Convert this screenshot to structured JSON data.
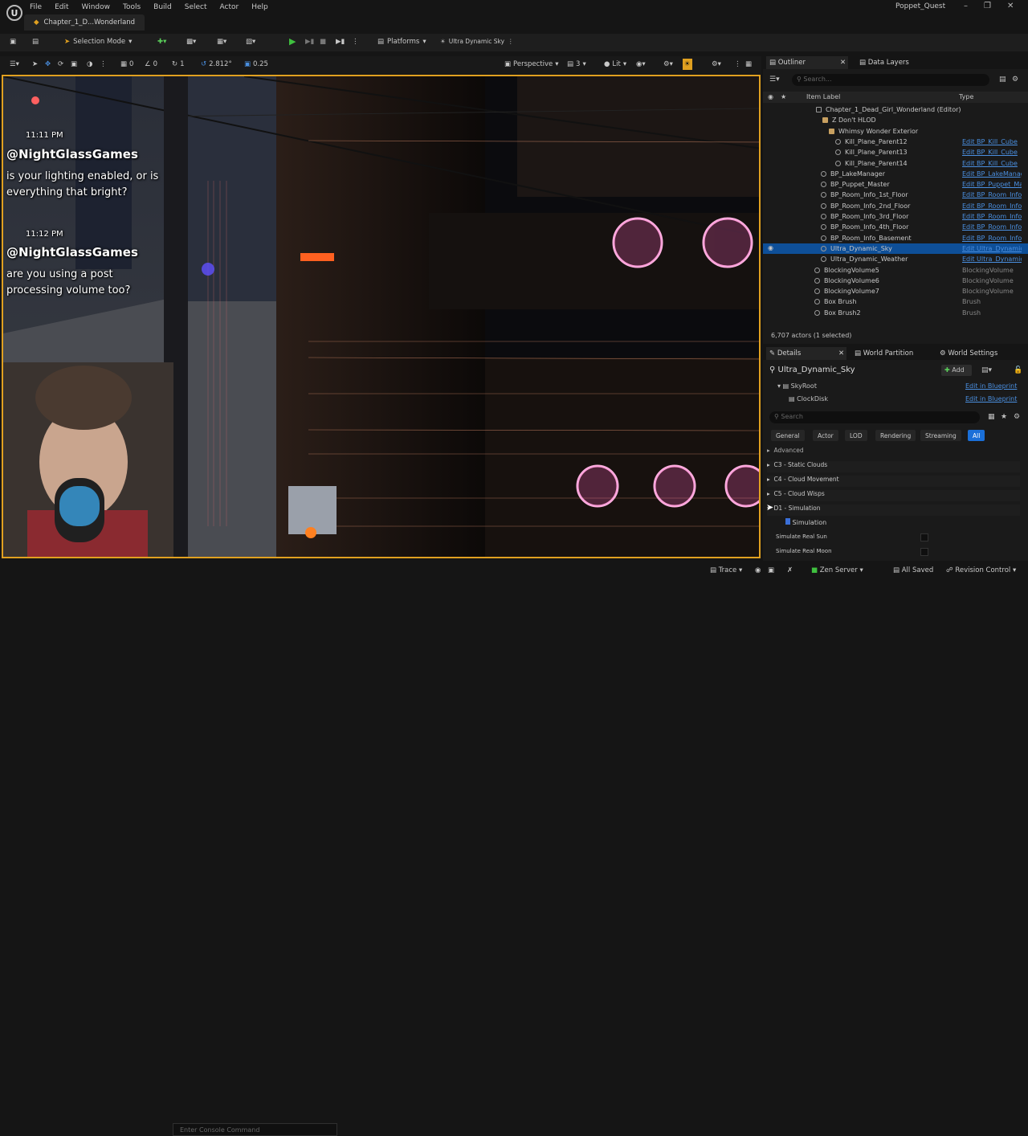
{
  "menu": [
    "File",
    "Edit",
    "Window",
    "Tools",
    "Build",
    "Select",
    "Actor",
    "Help"
  ],
  "project_name": "Poppet_Quest",
  "map_tab": "Chapter_1_D...Wonderland",
  "toolbar": {
    "selection_mode": "Selection Mode",
    "platforms": "Platforms",
    "sky": "Ultra Dynamic Sky"
  },
  "viewport_toolbar": {
    "snap_angle": "2.812°",
    "snap_scale": "0.25",
    "perspective": "Perspective",
    "lit": "Lit",
    "grid": "1",
    "angle": "0",
    "cam_speed": "3"
  },
  "chat": [
    {
      "time": "11:11 PM",
      "user": "@NightGlassGames",
      "text": "is your lighting enabled, or is everything that bright?"
    },
    {
      "time": "11:12 PM",
      "user": "@NightGlassGames",
      "text": "are you using a post processing volume too?"
    }
  ],
  "outliner": {
    "tab": "Outliner",
    "tab2": "Data Layers",
    "search_placeholder": "Search...",
    "col_label": "Item Label",
    "col_type": "Type",
    "rows": [
      {
        "label": "Chapter_1_Dead_Girl_Wonderland (Editor)",
        "type": ""
      },
      {
        "label": "Z Don't HLOD",
        "type": ""
      },
      {
        "label": "Whimsy Wonder Exterior",
        "type": ""
      },
      {
        "label": "Kill_Plane_Parent12",
        "type": "Edit BP_Kill_Cube"
      },
      {
        "label": "Kill_Plane_Parent13",
        "type": "Edit BP_Kill_Cube"
      },
      {
        "label": "Kill_Plane_Parent14",
        "type": "Edit BP_Kill_Cube"
      },
      {
        "label": "BP_LakeManager",
        "type": "Edit BP_LakeManag"
      },
      {
        "label": "BP_Puppet_Master",
        "type": "Edit BP_Puppet_Maste"
      },
      {
        "label": "BP_Room_Info_1st_Floor",
        "type": "Edit BP_Room_Info"
      },
      {
        "label": "BP_Room_Info_2nd_Floor",
        "type": "Edit BP_Room_Info"
      },
      {
        "label": "BP_Room_Info_3rd_Floor",
        "type": "Edit BP_Room_Info"
      },
      {
        "label": "BP_Room_Info_4th_Floor",
        "type": "Edit BP_Room_Info"
      },
      {
        "label": "BP_Room_Info_Basement",
        "type": "Edit BP_Room_Info"
      },
      {
        "label": "Ultra_Dynamic_Sky",
        "type": "Edit Ultra_Dynamic"
      },
      {
        "label": "Ultra_Dynamic_Weather",
        "type": "Edit Ultra_Dynamic"
      },
      {
        "label": "BlockingVolume5",
        "type": "BlockingVolume"
      },
      {
        "label": "BlockingVolume6",
        "type": "BlockingVolume"
      },
      {
        "label": "BlockingVolume7",
        "type": "BlockingVolume"
      },
      {
        "label": "Box Brush",
        "type": "Brush"
      },
      {
        "label": "Box Brush2",
        "type": "Brush"
      }
    ],
    "count": "6,707 actors (1 selected)"
  },
  "details": {
    "tab": "Details",
    "tab2": "World Partition",
    "tab3": "World Settings",
    "actor": "Ultra_Dynamic_Sky",
    "add": "Add",
    "components": [
      {
        "name": "SkyRoot",
        "link": "Edit in Blueprint"
      },
      {
        "name": "ClockDisk",
        "link": "Edit in Blueprint"
      }
    ],
    "search_placeholder": "Search",
    "filters": [
      "General",
      "Actor",
      "LOD",
      "Rendering",
      "Streaming",
      "All"
    ],
    "categories": [
      {
        "label": "Advanced"
      },
      {
        "label": "C3 - Static Clouds"
      },
      {
        "label": "C4 - Cloud Movement"
      },
      {
        "label": "C5 - Cloud Wisps"
      },
      {
        "label": "D1 - Simulation"
      }
    ],
    "sub_section": "Simulation",
    "props": [
      "Simulate Real Sun",
      "Simulate Real Moon"
    ]
  },
  "console_placeholder": "Enter Console Command",
  "status": {
    "trace": "Trace",
    "zen": "Zen Server",
    "saved": "All Saved",
    "rc": "Revision Control"
  }
}
